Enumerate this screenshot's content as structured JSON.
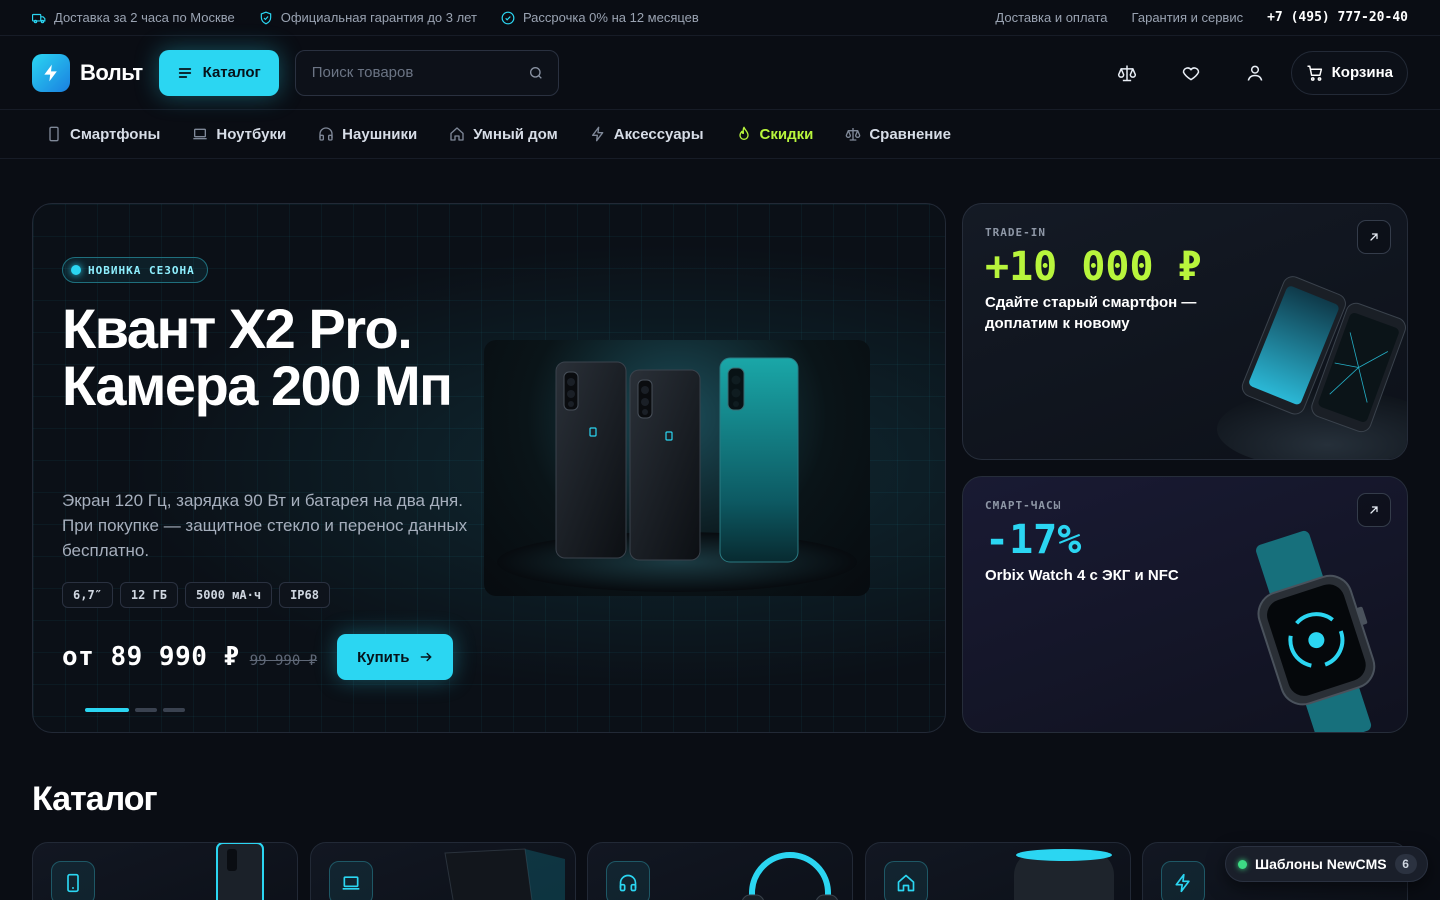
{
  "topbar": {
    "delivery": "Доставка за 2 часа по Москве",
    "warranty": "Официальная гарантия до 3 лет",
    "installment": "Рассрочка 0% на 12 месяцев",
    "link_delivery": "Доставка и оплата",
    "link_service": "Гарантия и сервис",
    "phone": "+7 (495) 777-20-40"
  },
  "header": {
    "logo": "Вольт",
    "catalog_label": "Каталог",
    "search_placeholder": "Поиск товаров",
    "cart_label": "Корзина",
    "icons": [
      "compare-icon",
      "heart-icon",
      "user-icon",
      "cart-icon"
    ]
  },
  "nav": [
    {
      "label": "Смартфоны",
      "icon": "smartphone-icon"
    },
    {
      "label": "Ноутбуки",
      "icon": "laptop-icon"
    },
    {
      "label": "Наушники",
      "icon": "headphones-icon"
    },
    {
      "label": "Умный дом",
      "icon": "home-icon"
    },
    {
      "label": "Аксессуары",
      "icon": "bolt-icon"
    },
    {
      "label": "Скидки",
      "icon": "flame-icon"
    },
    {
      "label": "Сравнение",
      "icon": "scales-icon"
    }
  ],
  "hero": {
    "badge": "НОВИНКА СЕЗОНА",
    "title": "Квант X2 Pro. Камера 200 Мп",
    "description": "Экран 120 Гц, зарядка 90 Вт и батарея на два дня. При покупке — защитное стекло и перенос данных бесплатно.",
    "specs": [
      "6,7″",
      "12 ГБ",
      "5000 мА·ч",
      "IP68"
    ],
    "price": "от 89 990 ₽",
    "old_price": "99 990 ₽",
    "buy_label": "Купить",
    "slides_total": 3,
    "slide_active": 1
  },
  "promos": {
    "trade_in": {
      "label": "TRADE-IN",
      "value": "+10 000 ₽",
      "text": "Сдайте старый смартфон — доплатим к новому"
    },
    "watch": {
      "label": "СМАРТ-ЧАСЫ",
      "value": "-17%",
      "text": "Orbix Watch 4 с ЭКГ и NFC"
    }
  },
  "catalog": {
    "title": "Каталог",
    "categories": [
      {
        "icon": "smartphone-icon"
      },
      {
        "icon": "laptop-icon"
      },
      {
        "icon": "headphones-icon"
      },
      {
        "icon": "home-icon"
      },
      {
        "icon": "bolt-icon"
      }
    ]
  },
  "widget": {
    "label": "Шаблоны NewCMS",
    "count": "6"
  },
  "colors": {
    "accent": "#2bd6f2",
    "hot": "#b8f53c",
    "background": "#0a0d14"
  }
}
